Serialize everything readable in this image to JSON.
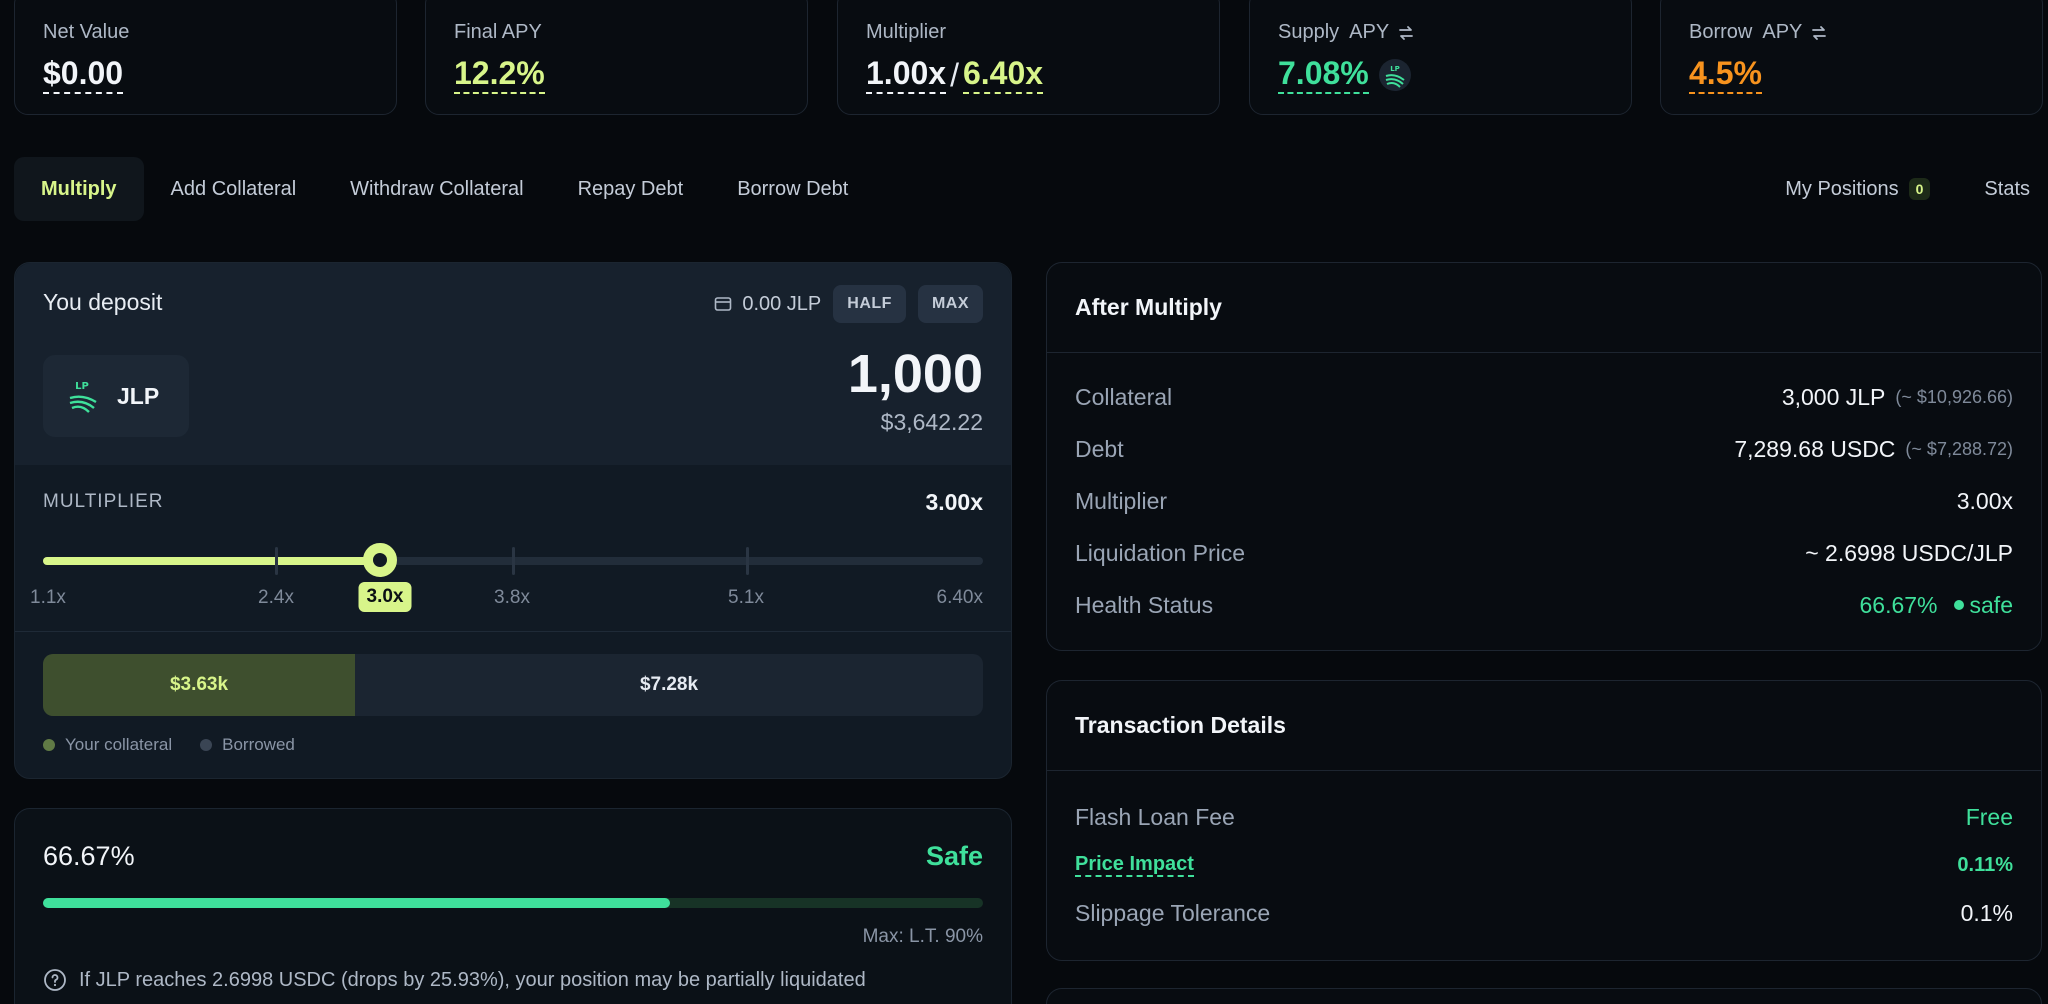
{
  "stats": {
    "net_value": {
      "label": "Net Value",
      "value": "$0.00"
    },
    "final_apy": {
      "label": "Final APY",
      "value": "12.2%"
    },
    "multiplier": {
      "label": "Multiplier",
      "current": "1.00x",
      "sep": "/",
      "max": "6.40x"
    },
    "supply_apy": {
      "label": "Supply  APY",
      "value": "7.08%",
      "token_icon": "jlp-lp-icon"
    },
    "borrow_apy": {
      "label": "Borrow  APY",
      "value": "4.5%"
    }
  },
  "tabs": [
    {
      "label": "Multiply",
      "active": true
    },
    {
      "label": "Add Collateral"
    },
    {
      "label": "Withdraw Collateral"
    },
    {
      "label": "Repay Debt"
    },
    {
      "label": "Borrow Debt"
    }
  ],
  "tabs_right": {
    "positions_label": "My Positions",
    "positions_count": "0",
    "stats_label": "Stats"
  },
  "deposit": {
    "title": "You deposit",
    "balance": "0.00 JLP",
    "half_label": "HALF",
    "max_label": "MAX",
    "token": "JLP",
    "token_badge": "LP",
    "amount": "1,000",
    "amount_usd": "$3,642.22"
  },
  "multiplier_slider": {
    "label": "MULTIPLIER",
    "value": "3.00x",
    "min": 1.1,
    "max": 6.4,
    "current": 3.0,
    "ticks": [
      "1.1x",
      "2.4x",
      "3.0x",
      "3.8x",
      "5.1x",
      "6.40x"
    ]
  },
  "split": {
    "collateral": "$3.63k",
    "borrowed": "$7.28k",
    "collateral_legend": "Your collateral",
    "borrowed_legend": "Borrowed"
  },
  "health": {
    "pct": "66.67%",
    "status": "Safe",
    "fill_fraction": 0.6667,
    "max_label": "Max: L.T. 90%",
    "note": "If JLP reaches 2.6998 USDC (drops by 25.93%), your position may be partially liquidated"
  },
  "after_multiply": {
    "title": "After Multiply",
    "rows": [
      {
        "label": "Collateral",
        "value": "3,000 JLP",
        "sub": "(~ $10,926.66)"
      },
      {
        "label": "Debt",
        "value": "7,289.68 USDC",
        "sub": "(~ $7,288.72)"
      },
      {
        "label": "Multiplier",
        "value": "3.00x",
        "sub": ""
      },
      {
        "label": "Liquidation Price",
        "value": "~ 2.6998 USDC/JLP",
        "sub": ""
      }
    ],
    "health_label": "Health Status",
    "health_value": "66.67%",
    "health_status": "safe"
  },
  "tx_details": {
    "title": "Transaction Details",
    "flash_fee_label": "Flash Loan Fee",
    "flash_fee_value": "Free",
    "price_impact_label": "Price Impact",
    "price_impact_value": "0.11%",
    "slippage_label": "Slippage Tolerance",
    "slippage_value": "0.1%"
  },
  "colors": {
    "accent": "#d8f58a",
    "green": "#3fe09b",
    "orange": "#f7931e"
  }
}
